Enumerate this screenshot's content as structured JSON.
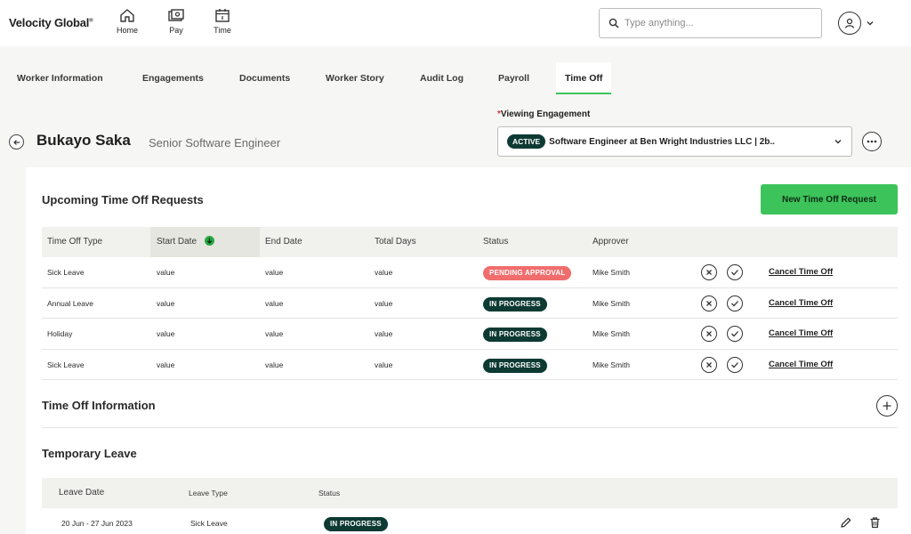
{
  "app": {
    "logo": "Velocity Global",
    "logo_mark": "®",
    "nav": [
      {
        "label": "Home",
        "icon": "home-icon"
      },
      {
        "label": "Pay",
        "icon": "pay-icon"
      },
      {
        "label": "Time",
        "icon": "calendar-icon"
      }
    ],
    "search": {
      "placeholder": "Type anything..."
    }
  },
  "tabs": [
    {
      "label": "Worker Information"
    },
    {
      "label": "Engagements"
    },
    {
      "label": "Documents"
    },
    {
      "label": "Worker Story"
    },
    {
      "label": "Audit Log"
    },
    {
      "label": "Payroll"
    },
    {
      "label": "Time Off",
      "active": true
    }
  ],
  "worker": {
    "name": "Bukayo Saka",
    "title": "Senior Software Engineer"
  },
  "engagement": {
    "required_mark": "*",
    "label": "Viewing Engagement",
    "badge": "ACTIVE",
    "value": "Software Engineer at Ben Wright Industries LLC | 2b.."
  },
  "upcoming": {
    "title": "Upcoming Time Off Requests",
    "new_button": "New Time Off Request",
    "columns": [
      "Time Off Type",
      "Start Date",
      "End Date",
      "Total Days",
      "Status",
      "Approver"
    ],
    "rows": [
      {
        "type": "Sick Leave",
        "start": "value",
        "end": "value",
        "days": "value",
        "status": "PENDING APPROVAL",
        "status_kind": "pending",
        "approver": "Mike Smith",
        "action": "Cancel Time Off"
      },
      {
        "type": "Annual Leave",
        "start": "value",
        "end": "value",
        "days": "value",
        "status": "IN PROGRESS",
        "status_kind": "progress",
        "approver": "Mike Smith",
        "action": "Cancel Time Off"
      },
      {
        "type": "Holiday",
        "start": "value",
        "end": "value",
        "days": "value",
        "status": "IN PROGRESS",
        "status_kind": "progress",
        "approver": "Mike Smith",
        "action": "Cancel Time Off"
      },
      {
        "type": "Sick Leave",
        "start": "value",
        "end": "value",
        "days": "value",
        "status": "IN PROGRESS",
        "status_kind": "progress",
        "approver": "Mike Smith",
        "action": "Cancel Time Off"
      }
    ]
  },
  "time_off_info": {
    "title": "Time Off Information"
  },
  "temporary": {
    "title": "Temporary Leave",
    "columns": [
      "Leave Date",
      "Leave Type",
      "Status"
    ],
    "rows": [
      {
        "date": "20 Jun - 27 Jun 2023",
        "type": "Sick Leave",
        "status": "IN PROGRESS"
      }
    ]
  },
  "colors": {
    "accent": "#3cc35a",
    "dark": "#0e3a34",
    "pending": "#f16d6d"
  }
}
